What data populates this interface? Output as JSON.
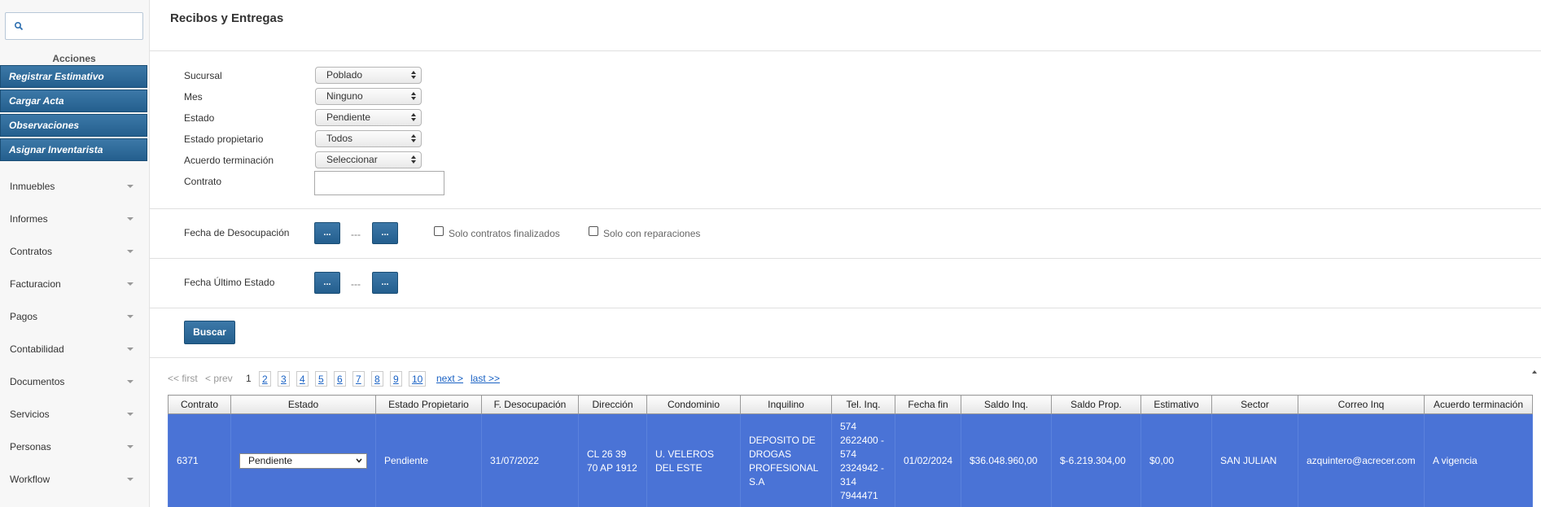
{
  "sidebar": {
    "search": {
      "placeholder": "",
      "value": ""
    },
    "actions_title": "Acciones",
    "actions": [
      "Registrar Estimativo",
      "Cargar Acta",
      "Observaciones",
      "Asignar Inventarista"
    ],
    "nav": [
      "Inmuebles",
      "Informes",
      "Contratos",
      "Facturacion",
      "Pagos",
      "Contabilidad",
      "Documentos",
      "Servicios",
      "Personas",
      "Workflow"
    ]
  },
  "page": {
    "title": "Recibos y Entregas"
  },
  "filters": {
    "sucursal": {
      "label": "Sucursal",
      "value": "Poblado"
    },
    "mes": {
      "label": "Mes",
      "value": "Ninguno"
    },
    "estado": {
      "label": "Estado",
      "value": "Pendiente"
    },
    "estado_propietario": {
      "label": "Estado propietario",
      "value": "Todos"
    },
    "acuerdo": {
      "label": "Acuerdo terminación",
      "value": "Seleccionar"
    },
    "contrato": {
      "label": "Contrato",
      "value": ""
    }
  },
  "fecha_desocupacion": {
    "label": "Fecha de Desocupación",
    "btn": "...",
    "sep": "---",
    "solo_finalizados": "Solo contratos finalizados",
    "solo_reparaciones": "Solo con reparaciones"
  },
  "fecha_ultimo": {
    "label": "Fecha Último Estado",
    "btn": "...",
    "sep": "---"
  },
  "buscar_label": "Buscar",
  "pagination": {
    "first": "<< first",
    "prev": "< prev",
    "current": "1",
    "pages": [
      "2",
      "3",
      "4",
      "5",
      "6",
      "7",
      "8",
      "9",
      "10"
    ],
    "next": "next >",
    "last": "last >>"
  },
  "table": {
    "headers": [
      "Contrato",
      "Estado",
      "Estado Propietario",
      "F. Desocupación",
      "Dirección",
      "Condominio",
      "Inquilino",
      "Tel. Inq.",
      "Fecha fin",
      "Saldo Inq.",
      "Saldo Prop.",
      "Estimativo",
      "Sector",
      "Correo Inq",
      "Acuerdo terminación"
    ],
    "row": {
      "contrato": "6371",
      "estado": "Pendiente",
      "estado_propietario": "Pendiente",
      "f_desocupacion": "31/07/2022",
      "direccion": "CL 26 39 70 AP 1912",
      "condominio": "U. VELEROS DEL ESTE",
      "inquilino": "DEPOSITO DE DROGAS PROFESIONAL S.A",
      "tel_inq": "574 2622400 - 574 2324942 - 314 7944471",
      "fecha_fin": "01/02/2024",
      "saldo_inq": "$36.048.960,00",
      "saldo_prop": "$-6.219.304,00",
      "estimativo": "$0,00",
      "sector": "SAN JULIAN",
      "correo_inq": "azquintero@acrecer.com",
      "acuerdo": "A vigencia"
    }
  },
  "colors": {
    "primary_button": "#2d6a9a",
    "row_selected": "#4a73d6",
    "link": "#1a62c4"
  }
}
